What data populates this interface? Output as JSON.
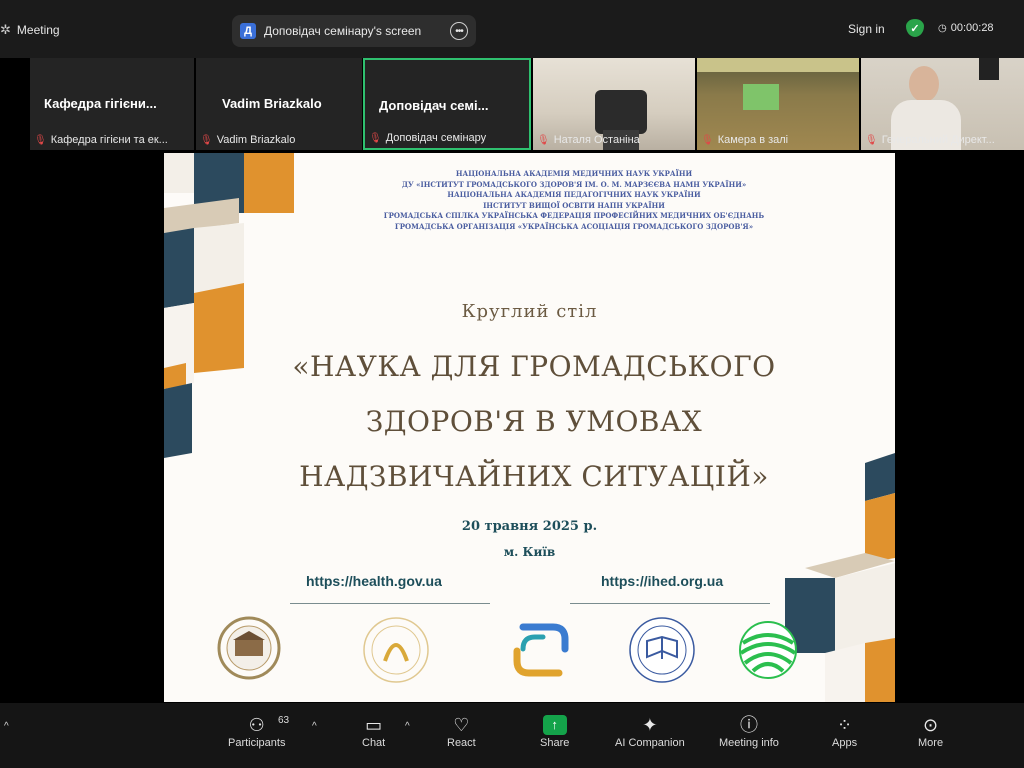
{
  "window": {
    "app_title": "Meeting"
  },
  "share_indicator": {
    "badge": "Д",
    "label": "Доповідач семінару's screen"
  },
  "top_right": {
    "sign_in": "Sign in",
    "timer": "00:00:28"
  },
  "participants_strip": [
    {
      "big_name": "Кафедра гігієни...",
      "name": "Кафедра гігієни та ек...",
      "video": false,
      "active": false
    },
    {
      "big_name": "Vadim Briazkalo",
      "name": "Vadim Briazkalo",
      "video": false,
      "active": false
    },
    {
      "big_name": "Доповідач семі...",
      "name": "Доповідач семінару",
      "video": false,
      "active": true
    },
    {
      "big_name": "",
      "name": "Наталя Останіна",
      "video": true,
      "active": false
    },
    {
      "big_name": "",
      "name": "Камера в залі",
      "video": true,
      "active": false
    },
    {
      "big_name": "",
      "name": "Генеральний Директ...",
      "video": true,
      "active": false
    }
  ],
  "slide": {
    "header_lines": [
      "НАЦІОНАЛЬНА АКАДЕМІЯ МЕДИЧНИХ НАУК УКРАЇНИ",
      "ДУ «ІНСТИТУТ ГРОМАДСЬКОГО ЗДОРОВ'Я ІМ. О. М. МАРЗЄЄВА НАМН УКРАЇНИ»",
      "НАЦІОНАЛЬНА АКАДЕМІЯ ПЕДАГОГІЧНИХ НАУК УКРАЇНИ",
      "ІНСТИТУТ ВИЩОЇ ОСВІТИ НАПН УКРАЇНИ",
      "ГРОМАДСЬКА СПІЛКА УКРАЇНСЬКА ФЕДЕРАЦІЯ ПРОФЕСІЙНИХ МЕДИЧНИХ ОБ'ЄДНАНЬ",
      "ГРОМАДСЬКА ОРГАНІЗАЦІЯ «УКРАЇНСЬКА АСОЦІАЦІЯ ГРОМАДСЬКОГО ЗДОРОВ'Я»"
    ],
    "subtitle": "Круглий стіл",
    "title_lines": [
      "«НАУКА ДЛЯ ГРОМАДСЬКОГО",
      "ЗДОРОВ'Я В УМОВАХ",
      "НАДЗВИЧАЙНИХ СИТУАЦІЙ»"
    ],
    "date": "20 травня 2025 р.",
    "city": "м. Київ",
    "link_left": "https://health.gov.ua",
    "link_right": "https://ihed.org.ua"
  },
  "toolbar": {
    "participants_count": "63",
    "items": [
      "Participants",
      "Chat",
      "React",
      "Share",
      "AI Companion",
      "Meeting info",
      "Apps",
      "More"
    ]
  },
  "colors": {
    "accent_orange": "#e0922e",
    "accent_navy": "#2c4a5e",
    "share_green": "#14a34a",
    "active_border": "#2fc06f"
  }
}
